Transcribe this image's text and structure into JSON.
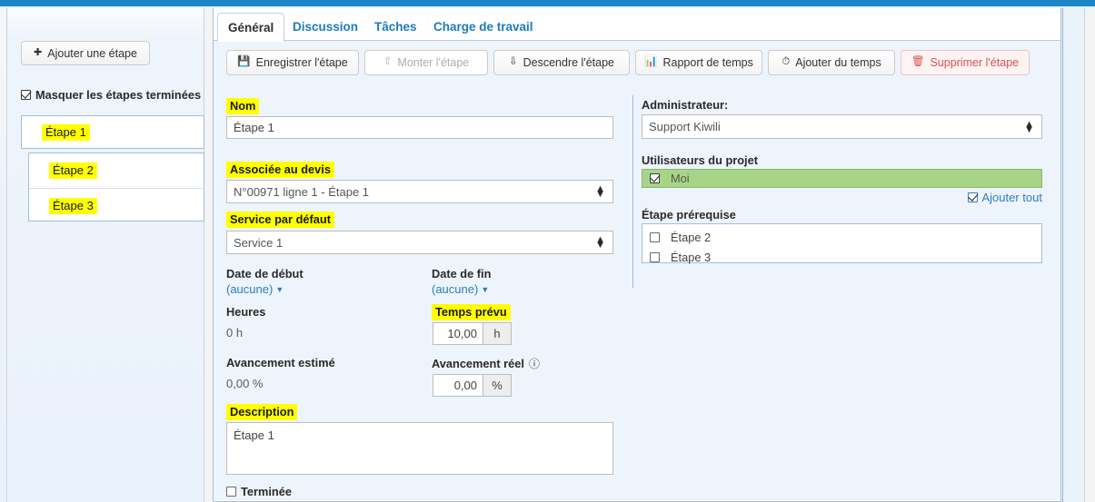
{
  "sidebar": {
    "add_step_label": "Ajouter une étape",
    "add_step_icon": "plus-circle-icon",
    "mask_finished_label": "Masquer les étapes terminées",
    "active_step": "Étape 1",
    "steps": [
      {
        "label": "Étape 2"
      },
      {
        "label": "Étape 3"
      }
    ]
  },
  "tabs": [
    {
      "label": "Général",
      "active": true
    },
    {
      "label": "Discussion",
      "active": false
    },
    {
      "label": "Tâches",
      "active": false
    },
    {
      "label": "Charge de travail",
      "active": false
    }
  ],
  "toolbar": {
    "save_label": "Enregistrer l'étape",
    "save_icon": "floppy-disk-icon",
    "move_up_label": "Monter l'étape",
    "move_up_icon": "arrow-up-icon",
    "move_down_label": "Descendre l'étape",
    "move_down_icon": "arrow-down-icon",
    "time_report_label": "Rapport de temps",
    "time_report_icon": "bar-chart-icon",
    "add_time_label": "Ajouter du temps",
    "add_time_icon": "clock-icon",
    "delete_label": "Supprimer l'étape",
    "delete_icon": "trash-icon"
  },
  "form": {
    "nom_label": "Nom",
    "nom_value": "Étape 1",
    "devis_label": "Associée au devis",
    "devis_value": "N°00971 ligne 1 - Étape 1",
    "service_label": "Service par défaut",
    "service_value": "Service 1",
    "date_debut_label": "Date de début",
    "date_debut_value": "(aucune)",
    "date_fin_label": "Date de fin",
    "date_fin_value": "(aucune)",
    "heures_label": "Heures",
    "heures_value": "0 h",
    "temps_prevu_label": "Temps prévu",
    "temps_prevu_value": "10,00",
    "temps_prevu_unit": "h",
    "avancement_estime_label": "Avancement estimé",
    "avancement_estime_value": "0,00 %",
    "avancement_reel_label": "Avancement réel",
    "avancement_reel_help_icon": "question-circle-icon",
    "avancement_reel_value": "0,00",
    "avancement_reel_unit": "%",
    "description_label": "Description",
    "description_value": "Étape 1",
    "terminee_label": "Terminée"
  },
  "right": {
    "admin_label": "Administrateur:",
    "admin_value": "Support Kiwili",
    "users_label": "Utilisateurs du projet",
    "user_selected": "Moi",
    "add_all_label": "Ajouter tout",
    "prereq_label": "Étape prérequise",
    "prereq_items": [
      {
        "label": "Étape 2"
      },
      {
        "label": "Étape 3"
      }
    ]
  },
  "colors": {
    "topbar": "#1b87c9",
    "highlight": "#ffff00",
    "link": "#2c7fb8",
    "selected_row": "#a7d588",
    "danger": "#d9534f"
  }
}
